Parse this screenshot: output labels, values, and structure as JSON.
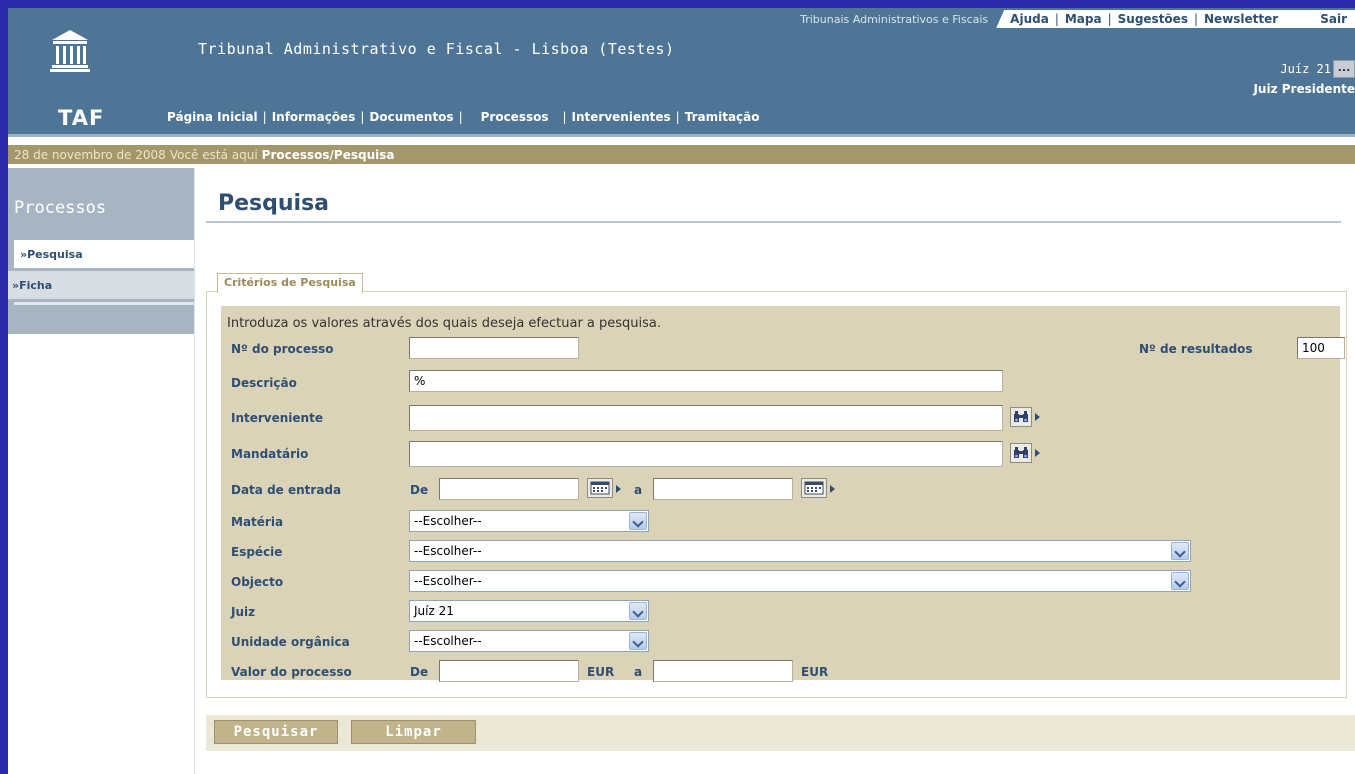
{
  "header": {
    "portal_link": "Tribunais Administrativos e Fiscais",
    "top_links": [
      "Ajuda",
      "Mapa",
      "Sugestões",
      "Newsletter"
    ],
    "logout": "Sair",
    "site_title": "Tribunal Administrativo e Fiscal - Lisboa (Testes)",
    "logo_text": "TAF",
    "user_name": "Juíz 21",
    "user_button": "...",
    "user_role": "Juiz Presidente",
    "main_nav": [
      "Página Inicial",
      "Informações",
      "Documentos",
      "Processos",
      "Intervenientes",
      "Tramitação"
    ]
  },
  "breadcrumb": {
    "date": "28 de novembro de 2008",
    "here_label": "Você está aqui",
    "path": "Processos/Pesquisa"
  },
  "sidebar": {
    "title": "Processos",
    "items": [
      {
        "label": "»Pesquisa",
        "active": true
      },
      {
        "label": "»Ficha",
        "active": false
      }
    ]
  },
  "main": {
    "title": "Pesquisa",
    "fieldset_legend": "Critérios de Pesquisa",
    "intro": "Introduza os valores através dos quais deseja efectuar a pesquisa.",
    "fields": {
      "process_number": {
        "label": "Nº do processo",
        "value": ""
      },
      "results_count": {
        "label": "Nº de resultados",
        "value": "100"
      },
      "description": {
        "label": "Descrição",
        "value": "%"
      },
      "intervenient": {
        "label": "Interveniente",
        "value": ""
      },
      "mandatary": {
        "label": "Mandatário",
        "value": ""
      },
      "entry_date": {
        "label": "Data de entrada",
        "from_label": "De",
        "to_label": "a",
        "from": "",
        "to": ""
      },
      "matter": {
        "label": "Matéria",
        "selected": "--Escolher--"
      },
      "species": {
        "label": "Espécie",
        "selected": "--Escolher--"
      },
      "object": {
        "label": "Objecto",
        "selected": "--Escolher--"
      },
      "judge": {
        "label": "Juiz",
        "selected": "Juíz 21"
      },
      "org_unit": {
        "label": "Unidade orgânica",
        "selected": "--Escolher--"
      },
      "process_value": {
        "label": "Valor do processo",
        "from_label": "De",
        "to_label": "a",
        "currency": "EUR",
        "from": "",
        "to": ""
      }
    },
    "buttons": {
      "search": "Pesquisar",
      "clear": "Limpar"
    }
  },
  "colors": {
    "frame": "#2a2aa8",
    "header": "#4e7596",
    "crumbbar": "#a4986a",
    "form_panel": "#dad3b8",
    "label": "#2f4f72",
    "button": "#c1b48a"
  },
  "icons": [
    "bank-logo-icon",
    "binoculars-icon",
    "calendar-icon",
    "chevron-down-icon"
  ]
}
